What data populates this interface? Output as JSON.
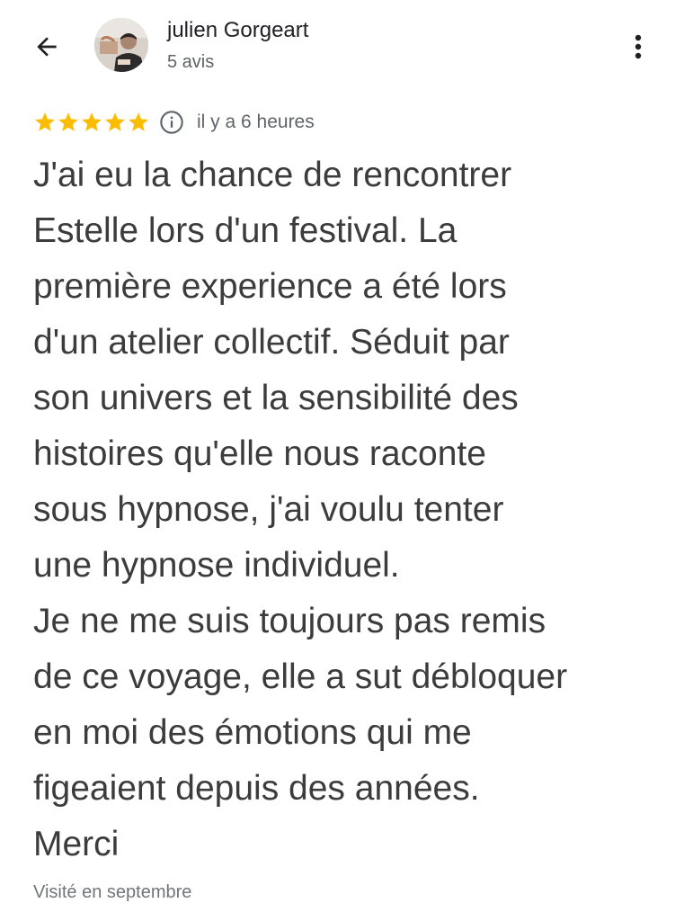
{
  "header": {
    "back_icon": "arrow-left-icon",
    "author_name": "julien Gorgeart",
    "author_reviews": "5 avis",
    "more_icon": "more-vertical-icon"
  },
  "review": {
    "rating": 5,
    "rating_max": 5,
    "star_color": "#fbbc04",
    "info_icon": "info-icon",
    "time": "il y a 6 heures",
    "text_lines": [
      "J'ai eu la chance de rencontrer",
      "Estelle lors d'un festival. La",
      "première experience a été lors",
      "d'un atelier collectif. Séduit par",
      "son univers et la sensibilité des",
      "histoires qu'elle nous raconte",
      "sous hypnose, j'ai voulu tenter",
      "une hypnose individuel.",
      "Je ne me suis toujours pas remis",
      "de ce voyage, elle a sut débloquer",
      "en moi des émotions qui me",
      "figeaient depuis des années.",
      "Merci"
    ],
    "visit": "Visité en septembre"
  }
}
